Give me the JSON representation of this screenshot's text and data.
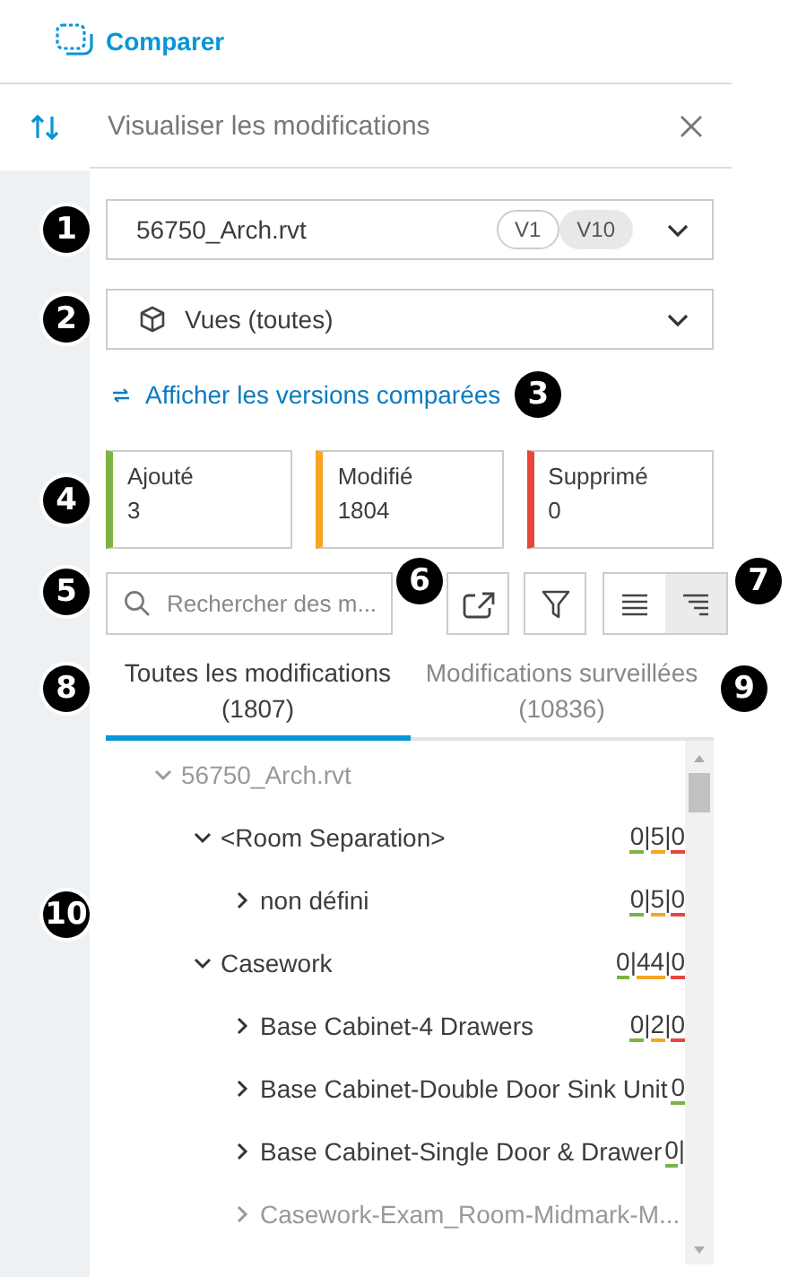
{
  "app": {
    "title": "Comparer"
  },
  "panel": {
    "title": "Visualiser les modifications"
  },
  "file_select": {
    "value": "56750_Arch.rvt",
    "versions": [
      {
        "label": "V1",
        "selected": false
      },
      {
        "label": "V10",
        "selected": true
      }
    ],
    "callout": "1"
  },
  "view_select": {
    "value": "Vues (toutes)",
    "callout": "2"
  },
  "versions_link": {
    "label": "Afficher les versions comparées",
    "callout": "3"
  },
  "summary": {
    "callout": "4",
    "cards": [
      {
        "label": "Ajouté",
        "count": "3",
        "color": "#7cb342"
      },
      {
        "label": "Modifié",
        "count": "1804",
        "color": "#f5a623"
      },
      {
        "label": "Supprimé",
        "count": "0",
        "color": "#e8453c"
      }
    ]
  },
  "search": {
    "placeholder": "Rechercher des m...",
    "callout": "5"
  },
  "export_callout": "6",
  "view_toggle": {
    "callout": "7",
    "options": [
      {
        "kind": "flat",
        "selected": false
      },
      {
        "kind": "tree",
        "selected": true
      }
    ]
  },
  "tabs": {
    "callouts": [
      "8",
      "9"
    ],
    "items": [
      {
        "label": "Toutes les modifications (1807)",
        "selected": true
      },
      {
        "label": "Modifications surveillées (10836)",
        "selected": false
      }
    ]
  },
  "tree": {
    "callout": "10",
    "items": [
      {
        "label": "56750_Arch.rvt",
        "expanded": true,
        "dimmed": true,
        "children": [
          {
            "label": "<Room Separation>",
            "counts": "0|5|0",
            "expanded": true,
            "dimmed": false,
            "children": [
              {
                "label": "non défini",
                "counts": "0|5|0",
                "expanded": false,
                "dimmed": false
              }
            ]
          },
          {
            "label": "Casework",
            "counts": "0|44|0",
            "expanded": true,
            "dimmed": false,
            "children": [
              {
                "label": "Base Cabinet-4 Drawers",
                "counts": "0|2|0",
                "expanded": false,
                "dimmed": false
              },
              {
                "label": "Base Cabinet-Double Door Sink Unit",
                "counts": "0",
                "expanded": false,
                "dimmed": false
              },
              {
                "label": "Base Cabinet-Single Door & Drawer",
                "counts": "0|",
                "expanded": false,
                "dimmed": false
              },
              {
                "label": "Casework-Exam_Room-Midmark-M...",
                "expanded": false,
                "dimmed": true
              }
            ]
          }
        ]
      }
    ]
  }
}
